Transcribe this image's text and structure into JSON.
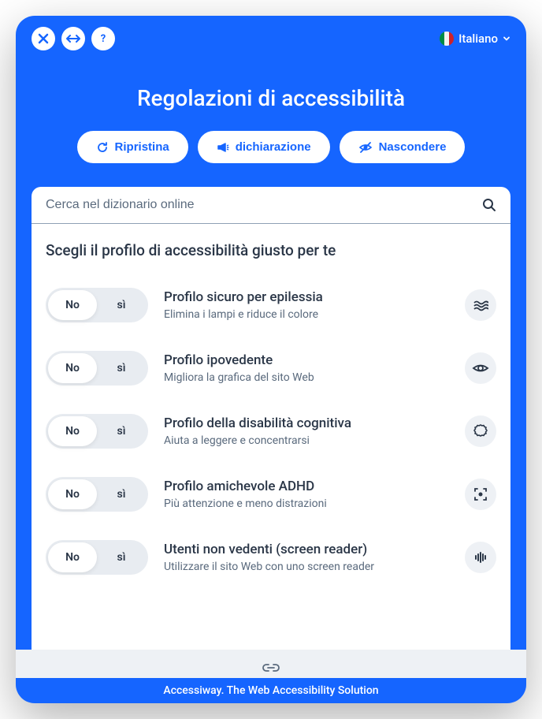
{
  "language": {
    "label": "Italiano"
  },
  "header": {
    "title": "Regolazioni di accessibilità"
  },
  "actions": {
    "reset": "Ripristina",
    "statement": "dichiarazione",
    "hide": "Nascondere"
  },
  "search": {
    "placeholder": "Cerca nel dizionario online"
  },
  "section_title": "Scegli il profilo di accessibilità giusto per te",
  "toggle": {
    "no": "No",
    "yes": "sì"
  },
  "profiles": [
    {
      "title": "Profilo sicuro per epilessia",
      "desc": "Elimina i lampi e riduce il colore"
    },
    {
      "title": "Profilo ipovedente",
      "desc": "Migliora la grafica del sito Web"
    },
    {
      "title": "Profilo della disabilità cognitiva",
      "desc": "Aiuta a leggere e concentrarsi"
    },
    {
      "title": "Profilo amichevole ADHD",
      "desc": "Più attenzione e meno distrazioni"
    },
    {
      "title": "Utenti non vedenti (screen reader)",
      "desc": "Utilizzare il sito Web con uno screen reader"
    }
  ],
  "footer": "Accessiway. The Web Accessibility Solution"
}
